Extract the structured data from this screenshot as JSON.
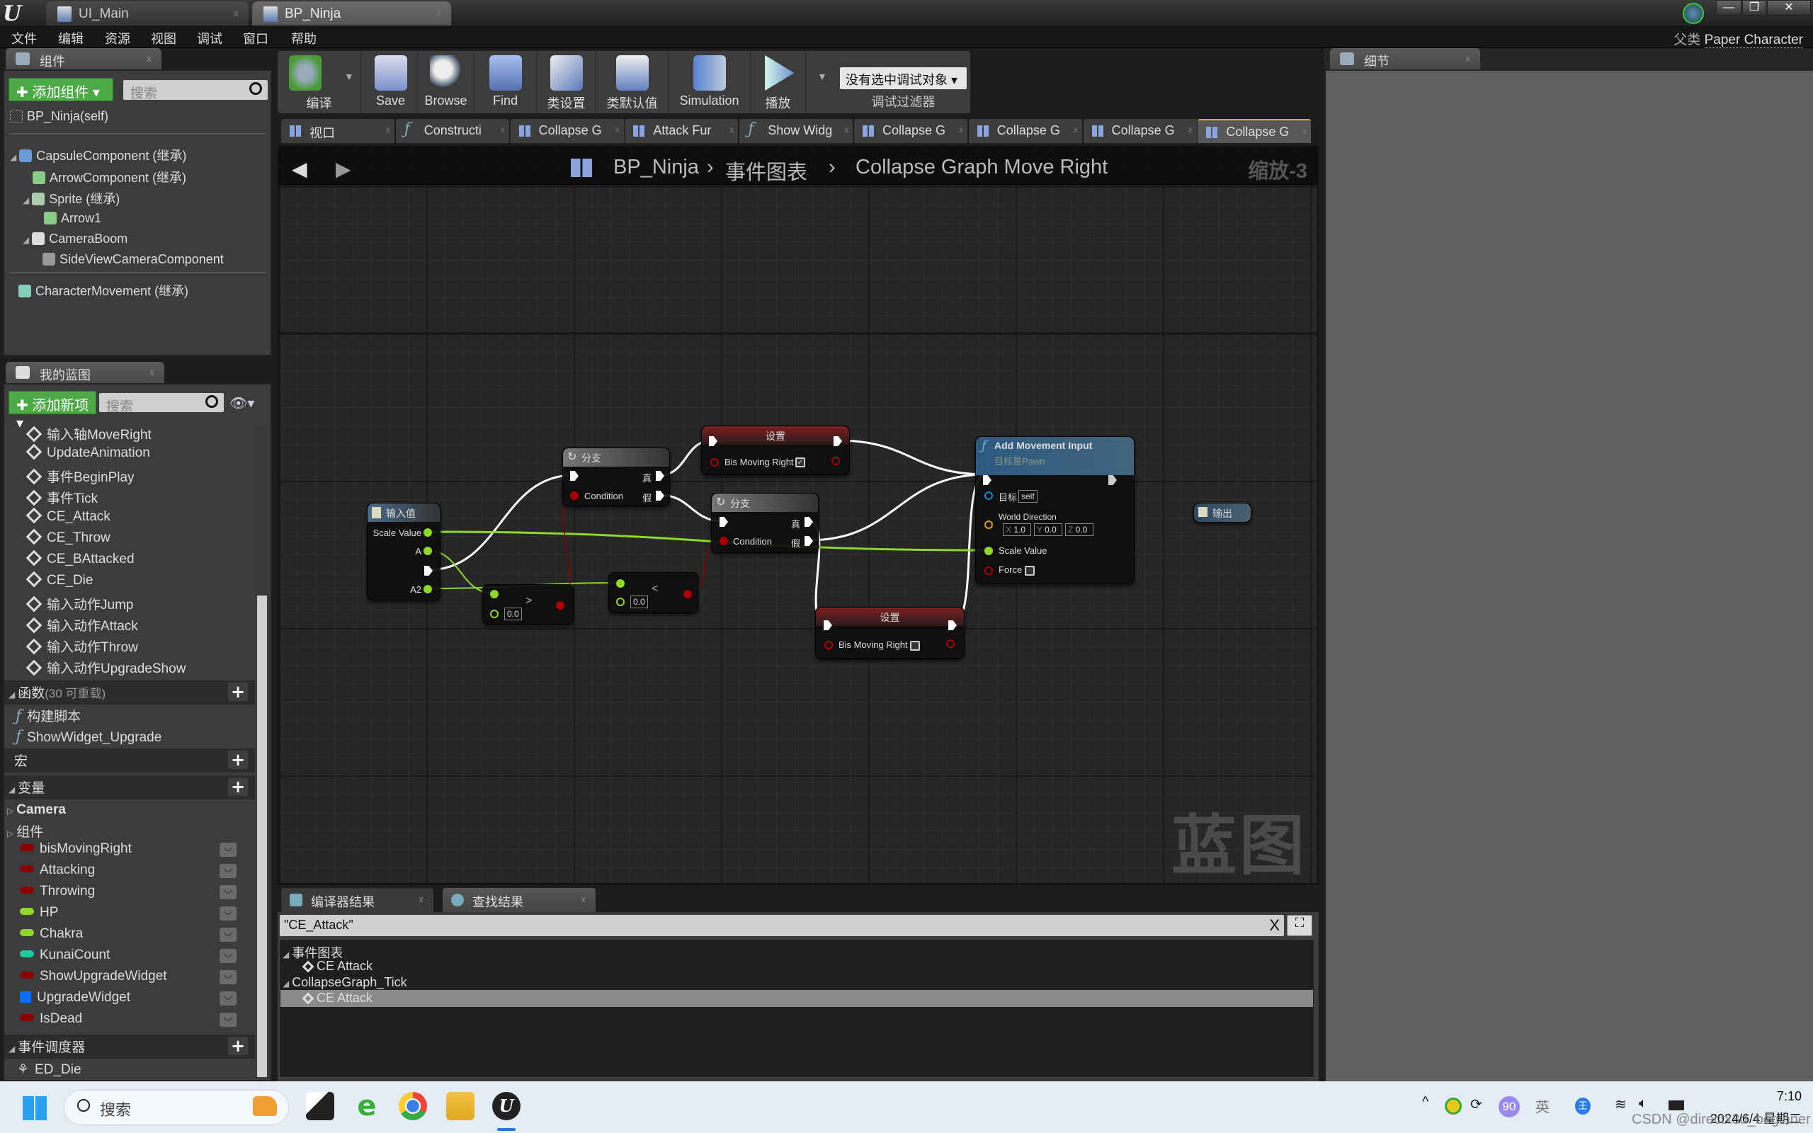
{
  "titlebar": {
    "tabs": [
      {
        "label": "UI_Main"
      },
      {
        "label": "BP_Ninja"
      }
    ],
    "active_tab": "BP_Ninja",
    "close_glyph": "x",
    "window_controls": {
      "minimize": "—",
      "restore": "❐",
      "close": "✕"
    }
  },
  "menu": {
    "items": [
      "文件",
      "编辑",
      "资源",
      "视图",
      "调试",
      "窗口",
      "帮助"
    ]
  },
  "parent_class": {
    "label": "父类",
    "value": "Paper Character"
  },
  "components_panel": {
    "tab": "组件",
    "add_button": "添加组件",
    "search_placeholder": "搜索",
    "self_item": "BP_Ninja(self)",
    "tree": [
      {
        "label": "CapsuleComponent (继承)",
        "icon": "capsule-icon",
        "expanded": true
      },
      {
        "label": "ArrowComponent (继承)",
        "icon": "arrow-icon"
      },
      {
        "label": "Sprite (继承)",
        "icon": "sprite-icon",
        "expanded": true
      },
      {
        "label": "Arrow1",
        "icon": "arrow-icon"
      },
      {
        "label": "CameraBoom",
        "icon": "spring-arm-icon",
        "expanded": true
      },
      {
        "label": "SideViewCameraComponent",
        "icon": "camera-icon"
      },
      {
        "label": "CharacterMovement (继承)",
        "icon": "movement-icon"
      }
    ]
  },
  "my_blueprint": {
    "tab": "我的蓝图",
    "add_button": "添加新项",
    "search_placeholder": "搜索",
    "graph_items": [
      "输入轴MoveRight",
      "UpdateAnimation",
      "事件BeginPlay",
      "事件Tick",
      "CE_Attack",
      "CE_Throw",
      "CE_BAttacked",
      "CE_Die",
      "输入动作Jump",
      "输入动作Attack",
      "输入动作Throw",
      "输入动作UpgradeShow"
    ],
    "functions": {
      "label": "函数",
      "note": "(30 可重载)",
      "items": [
        "构建脚本",
        "ShowWidget_Upgrade"
      ]
    },
    "macros": {
      "label": "宏"
    },
    "variables": {
      "label": "变量",
      "categories": [
        "Camera",
        "组件"
      ],
      "items": [
        {
          "name": "bisMovingRight",
          "color": "#8b0000"
        },
        {
          "name": "Attacking",
          "color": "#8b0000"
        },
        {
          "name": "Throwing",
          "color": "#8b0000"
        },
        {
          "name": "HP",
          "color": "#8fd82a"
        },
        {
          "name": "Chakra",
          "color": "#8fd82a"
        },
        {
          "name": "KunaiCount",
          "color": "#1fc9a0"
        },
        {
          "name": "ShowUpgradeWidget",
          "color": "#8b0000"
        },
        {
          "name": "UpgradeWidget",
          "color": "#0a6cff"
        },
        {
          "name": "IsDead",
          "color": "#8b0000"
        }
      ]
    },
    "dispatchers": {
      "label": "事件调度器",
      "items": [
        "ED_Die"
      ]
    }
  },
  "toolbar": {
    "buttons": [
      {
        "label": "编译",
        "icon": "compile-icon"
      },
      {
        "label": "Save",
        "icon": "save-icon"
      },
      {
        "label": "Browse",
        "icon": "browse-icon"
      },
      {
        "label": "Find",
        "icon": "find-icon"
      },
      {
        "label": "类设置",
        "icon": "class-settings-icon"
      },
      {
        "label": "类默认值",
        "icon": "class-defaults-icon"
      },
      {
        "label": "Simulation",
        "icon": "simulation-icon"
      },
      {
        "label": "播放",
        "icon": "play-icon"
      }
    ],
    "debug_dropdown": "没有选中调试对象",
    "debug_filter_label": "调试过滤器"
  },
  "graph_tabs": [
    {
      "label": "视口",
      "icon": "viewport-icon"
    },
    {
      "label": "Constructi",
      "icon": "function-icon"
    },
    {
      "label": "Collapse G",
      "icon": "graph-icon"
    },
    {
      "label": "Attack Fur",
      "icon": "graph-icon"
    },
    {
      "label": "Show Widg",
      "icon": "function-icon"
    },
    {
      "label": "Collapse G",
      "icon": "graph-icon"
    },
    {
      "label": "Collapse G",
      "icon": "graph-icon"
    },
    {
      "label": "Collapse G",
      "icon": "graph-icon"
    },
    {
      "label": "Collapse G",
      "icon": "graph-icon",
      "active": true
    }
  ],
  "graph": {
    "breadcrumb": [
      "BP_Ninja",
      "事件图表",
      "Collapse Graph Move Right"
    ],
    "separator": "›",
    "zoom": "缩放-3",
    "watermark": "蓝图",
    "nodes": {
      "input": {
        "title": "输入值",
        "pins": [
          "Scale Value",
          "A",
          "A2"
        ]
      },
      "branch1": {
        "title": "分支",
        "condition": "Condition",
        "true": "真",
        "false": "假"
      },
      "branch2": {
        "title": "分支",
        "condition": "Condition",
        "true": "真",
        "false": "假"
      },
      "set1": {
        "title": "设置",
        "var": "Bis Moving Right",
        "checked": true
      },
      "set2": {
        "title": "设置",
        "var": "Bis Moving Right",
        "checked": false
      },
      "compare1": {
        "op": ">",
        "value": "0.0"
      },
      "compare2": {
        "op": "<",
        "value": "0.0"
      },
      "add_movement": {
        "title": "Add Movement Input",
        "subtitle": "目标是Pawn",
        "target_label": "目标",
        "target_value": "self",
        "world_direction": "World Direction",
        "x": "1.0",
        "y": "0.0",
        "z": "0.0",
        "scale": "Scale Value",
        "force": "Force"
      },
      "output": {
        "title": "输出"
      }
    },
    "pin_colors": {
      "exec": "#ffffff",
      "bool": "#8b0000",
      "float": "#8fd82a",
      "object": "#0a8fe0",
      "vector": "#e2a500"
    }
  },
  "bottom": {
    "tabs": [
      "编译器结果",
      "查找结果"
    ],
    "search_value": "\"CE_Attack\"",
    "clear": "X",
    "results": [
      {
        "label": "事件图表",
        "type": "group"
      },
      {
        "label": "CE Attack",
        "type": "item"
      },
      {
        "label": "CollapseGraph_Tick",
        "type": "group"
      },
      {
        "label": "CE Attack",
        "type": "item",
        "selected": true
      }
    ]
  },
  "details_panel": {
    "tab": "细节"
  },
  "taskbar": {
    "search_placeholder": "搜索",
    "tray_badge": "90",
    "ime": "英",
    "time": "7:10",
    "date": "2024/6/4 星期二",
    "watermark": "CSDN @directx3d_beginner"
  }
}
